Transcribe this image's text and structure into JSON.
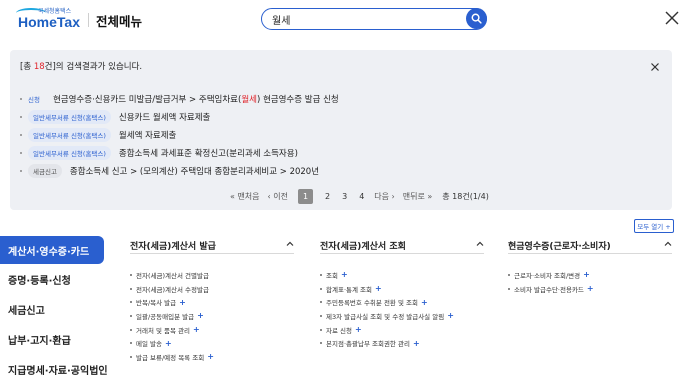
{
  "header": {
    "logo_small": "국세청홈택스",
    "logo_big": "HomeTax",
    "menu_title": "전체메뉴",
    "search_value": "월세"
  },
  "results": {
    "count_prefix": "[총 ",
    "count_num": "18",
    "count_suffix": "건]의 검색결과가 있습니다.",
    "items": [
      {
        "tag": "신청",
        "text_before": "현금영수증·신용카드 미발급/발급거부 > 주택임차료(",
        "highlight": "월세",
        "text_after": ") 현금영수증 발급 신청"
      },
      {
        "tag": "일반세무서류 신청(홈택스)",
        "text_before": "신용카드 ",
        "highlight": "월세",
        "text_after": "액 자료제출"
      },
      {
        "tag": "일반세무서류 신청(홈택스)",
        "text_before": "",
        "highlight": "월세",
        "text_after": "액 자료제출"
      },
      {
        "tag": "일반세무서류 신청(홈택스)",
        "text_before": "종합소득세 과세표준 확정신고(분리과세 소득자용)",
        "highlight": "",
        "text_after": ""
      },
      {
        "tag": "세금신고",
        "text_before": "종합소득세 신고 > (모의계산) 주택임대 종합분리과세비교 > 2020년",
        "highlight": "",
        "text_after": ""
      }
    ],
    "pagination": {
      "first": "« 맨처음",
      "prev": "‹ 이전",
      "current": "1",
      "pages": [
        "2",
        "3",
        "4"
      ],
      "next": "다음 ›",
      "last": "맨뒤로 »",
      "total": "총 18건(1/4)"
    }
  },
  "expand_all": "모두 열기 +",
  "leftnav": {
    "items": [
      "계산서·영수증·카드",
      "증명·등록·신청",
      "세금신고",
      "납부·고지·환급",
      "지급명세·자료·공익법인"
    ]
  },
  "columns": [
    {
      "title": "전자(세금)계산서 발급",
      "items": [
        {
          "label": "전자(세금)계산서 건별발급",
          "plus": false
        },
        {
          "label": "전자(세금)계산서 수정발급",
          "plus": false
        },
        {
          "label": "반복/복사 발급",
          "plus": true
        },
        {
          "label": "일괄/공동매입분 발급",
          "plus": true
        },
        {
          "label": "거래처 및 품목 관리",
          "plus": true
        },
        {
          "label": "메일 발송",
          "plus": true
        },
        {
          "label": "발급 보류/예정 목록 조회",
          "plus": true
        }
      ]
    },
    {
      "title": "전자(세금)계산서 조회",
      "items": [
        {
          "label": "조회",
          "plus": true
        },
        {
          "label": "합계표·통계 조회",
          "plus": true
        },
        {
          "label": "주민등록번호 수취분 전환 및 조회",
          "plus": true
        },
        {
          "label": "제3자 발급사실 조회 및 수정 발급사실 알림",
          "plus": true
        },
        {
          "label": "자료 신청",
          "plus": true
        },
        {
          "label": "본지점·총괄납부 조회권한 관리",
          "plus": true
        }
      ]
    },
    {
      "title": "현금영수증(근로자·소비자)",
      "items": [
        {
          "label": "근로자·소비자 조회/변경",
          "plus": true
        },
        {
          "label": "소비자 발급수단·전용카드",
          "plus": true
        }
      ]
    }
  ],
  "colors": {
    "accent": "#2a5fcf",
    "highlight": "#e0262d"
  }
}
